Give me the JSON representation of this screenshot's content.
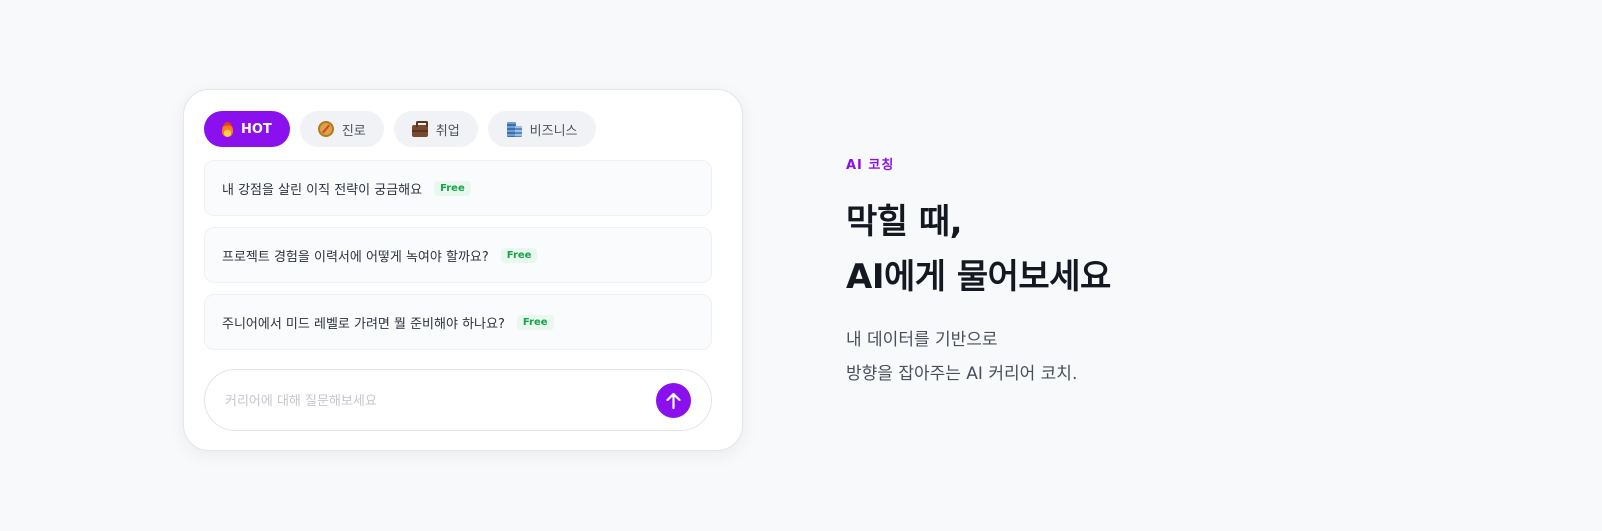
{
  "chat": {
    "tabs": [
      {
        "label": "HOT",
        "icon": "flame-icon",
        "active": true
      },
      {
        "label": "진로",
        "icon": "compass-icon",
        "active": false
      },
      {
        "label": "취업",
        "icon": "briefcase-icon",
        "active": false
      },
      {
        "label": "비즈니스",
        "icon": "office-building-icon",
        "active": false
      }
    ],
    "questions": [
      {
        "text": "내 강점을 살린 이직 전략이 궁금해요",
        "badge": "Free"
      },
      {
        "text": "프로젝트 경험을 이력서에 어떻게 녹여야 할까요?",
        "badge": "Free"
      },
      {
        "text": "주니어에서 미드 레벨로 가려면 뭘 준비해야 하나요?",
        "badge": "Free"
      }
    ],
    "input": {
      "placeholder": "커리어에 대해 질문해보세요",
      "value": ""
    },
    "send_icon": "arrow-up-icon"
  },
  "hero": {
    "eyebrow": "AI 코칭",
    "headline_line1": "막힐 때,",
    "headline_line2": "AI에게 물어보세요",
    "sub_line1": "내 데이터를 기반으로",
    "sub_line2": "방향을 잡아주는 AI 커리어 코치."
  },
  "colors": {
    "accent": "#8b10ee",
    "badge_text": "#16a34a",
    "background": "#f8f9fb"
  }
}
